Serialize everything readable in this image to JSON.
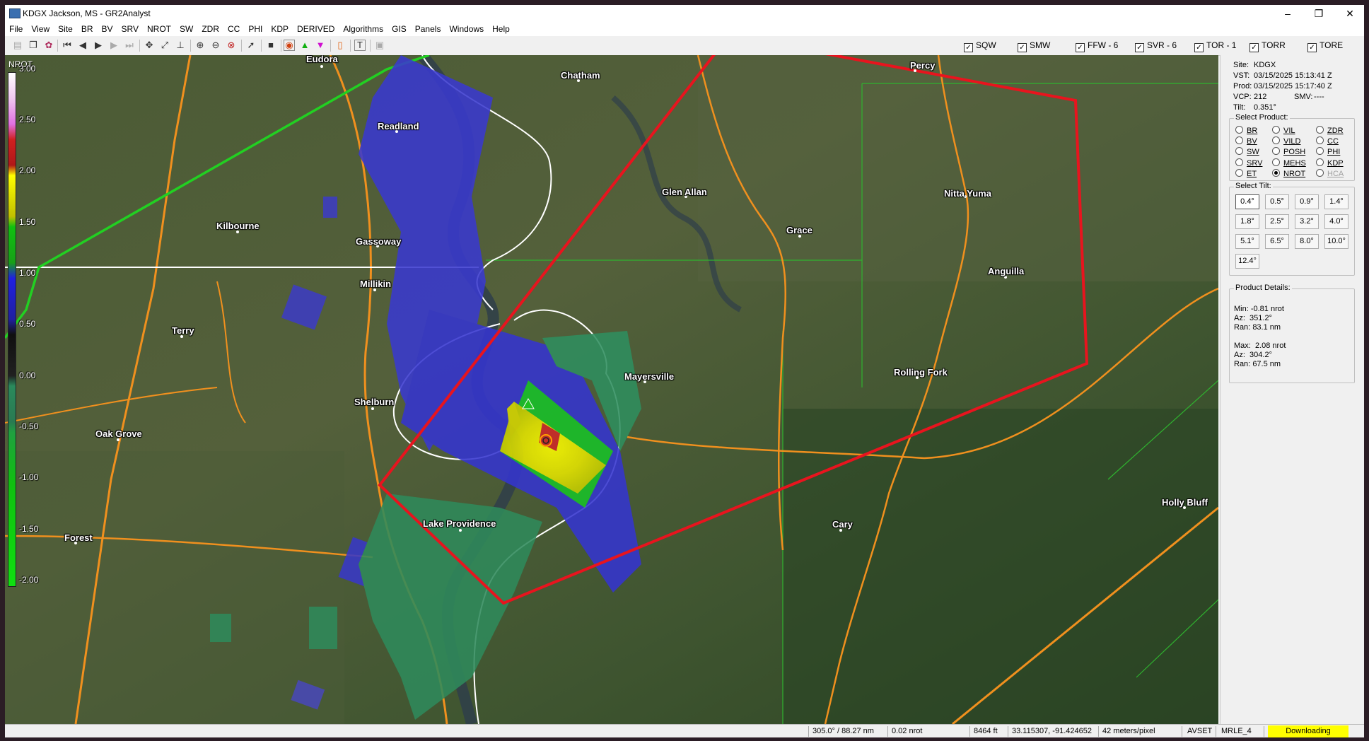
{
  "window": {
    "title": "KDGX Jackson, MS - GR2Analyst",
    "minimize": "–",
    "maximize": "❐",
    "close": "✕"
  },
  "menu": [
    "File",
    "View",
    "Site",
    "BR",
    "BV",
    "SRV",
    "NROT",
    "SW",
    "ZDR",
    "CC",
    "PHI",
    "KDP",
    "DERIVED",
    "Algorithms",
    "GIS",
    "Panels",
    "Windows",
    "Help"
  ],
  "warnings": [
    {
      "label": "SQW",
      "checked": true
    },
    {
      "label": "SMW",
      "checked": true
    },
    {
      "label": "FFW - 6",
      "checked": true
    },
    {
      "label": "SVR - 6",
      "checked": true
    },
    {
      "label": "TOR - 1",
      "checked": true
    },
    {
      "label": "TORR",
      "checked": true
    },
    {
      "label": "TORE",
      "checked": true
    }
  ],
  "legend": {
    "product": "NROT",
    "ticks": [
      "3.00",
      "2.50",
      "2.00",
      "1.50",
      "1.00",
      "0.50",
      "0.00",
      "-0.50",
      "-1.00",
      "-1.50",
      "-2.00"
    ]
  },
  "towns": [
    "Eudora",
    "Chatham",
    "Percy",
    "Readland",
    "Glen Allan",
    "Nitta Yuma",
    "Kilbourne",
    "Gassoway",
    "Grace",
    "Millikin",
    "Anguilla",
    "Terry",
    "Mayersville",
    "Rolling Fork",
    "Shelburn",
    "Oak Grove",
    "Lake Providence",
    "Cary",
    "Holly Bluff",
    "Forest"
  ],
  "site_info": {
    "site_label": "Site:",
    "site": "KDGX",
    "vst_label": "VST:",
    "vst": "03/15/2025 15:13:41 Z",
    "prod_label": "Prod:",
    "prod": "03/15/2025 15:17:40 Z",
    "vcp_label": "VCP:",
    "vcp": "212",
    "smv_label": "SMV:",
    "smv": "----",
    "tilt_label": "Tilt:",
    "tilt": "0.351°"
  },
  "select_product": {
    "title": "Select Product:",
    "options": [
      {
        "label": "BR",
        "selected": false,
        "enabled": true
      },
      {
        "label": "VIL",
        "selected": false,
        "enabled": true
      },
      {
        "label": "ZDR",
        "selected": false,
        "enabled": true
      },
      {
        "label": "BV",
        "selected": false,
        "enabled": true
      },
      {
        "label": "VILD",
        "selected": false,
        "enabled": true
      },
      {
        "label": "CC",
        "selected": false,
        "enabled": true
      },
      {
        "label": "SW",
        "selected": false,
        "enabled": true
      },
      {
        "label": "POSH",
        "selected": false,
        "enabled": true
      },
      {
        "label": "PHI",
        "selected": false,
        "enabled": true
      },
      {
        "label": "SRV",
        "selected": false,
        "enabled": true
      },
      {
        "label": "MEHS",
        "selected": false,
        "enabled": true
      },
      {
        "label": "KDP",
        "selected": false,
        "enabled": true
      },
      {
        "label": "ET",
        "selected": false,
        "enabled": true
      },
      {
        "label": "NROT",
        "selected": true,
        "enabled": true
      },
      {
        "label": "HCA",
        "selected": false,
        "enabled": false
      }
    ]
  },
  "select_tilt": {
    "title": "Select Tilt:",
    "options": [
      "0.4°",
      "0.5°",
      "0.9°",
      "1.4°",
      "1.8°",
      "2.5°",
      "3.2°",
      "4.0°",
      "5.1°",
      "6.5°",
      "8.0°",
      "10.0°",
      "12.4°"
    ],
    "selected": "0.4°"
  },
  "product_details": {
    "title": "Product Details:",
    "min_label": "Min:",
    "min": "-0.81 nrot",
    "min_az_label": "Az:",
    "min_az": "351.2°",
    "min_ran_label": "Ran:",
    "min_ran": "83.1 nm",
    "max_label": "Max:",
    "max": "2.08 nrot",
    "max_az_label": "Az:",
    "max_az": "304.2°",
    "max_ran_label": "Ran:",
    "max_ran": "67.5 nm"
  },
  "status": {
    "azran": "305.0° / 88.27 nm",
    "value": "0.02 nrot",
    "height": "8464 ft",
    "latlon": "33.115307, -91.424652",
    "scale": "42 meters/pixel",
    "avset": "AVSET",
    "mrle": "MRLE_4",
    "download": "Downloading"
  },
  "colors": {
    "tornado_warning": "#e8141e",
    "county_line": "#ffffff",
    "highway": "#f0901e",
    "download_bg": "#ffff00"
  }
}
